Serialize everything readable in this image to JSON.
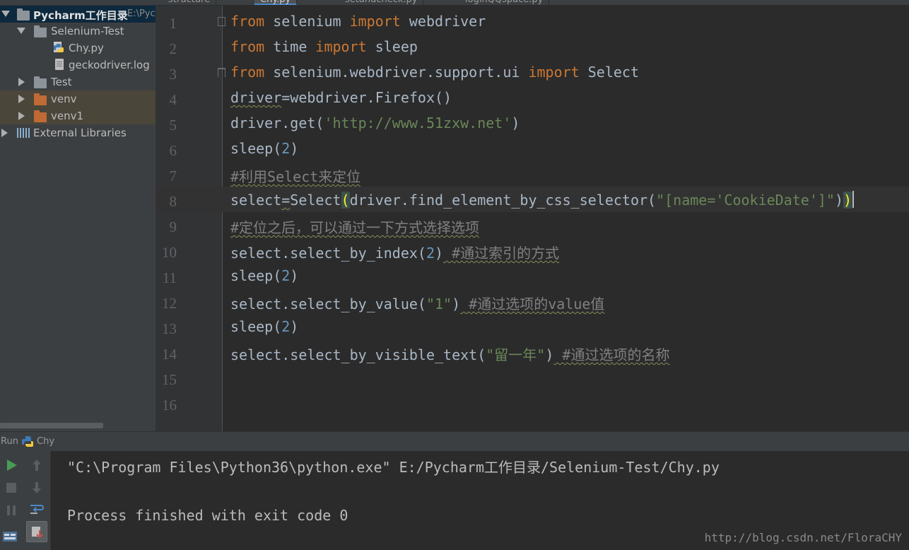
{
  "project_tree": {
    "root": {
      "label": "Pycharm工作目录",
      "path_hint": "E:\\Pyc"
    },
    "items": [
      {
        "label": "Selenium-Test"
      },
      {
        "label": "Chy.py"
      },
      {
        "label": "geckodriver.log"
      },
      {
        "label": "Test"
      },
      {
        "label": "venv"
      },
      {
        "label": "venv1"
      },
      {
        "label": "External Libraries"
      }
    ]
  },
  "editor_tabs": [
    "structure",
    "Chy.py",
    "setandcheck.py",
    "loginQQspace.py"
  ],
  "editor": {
    "line_numbers": [
      "1",
      "2",
      "3",
      "4",
      "5",
      "6",
      "7",
      "8",
      "9",
      "10",
      "11",
      "12",
      "13",
      "14",
      "15",
      "16"
    ],
    "tokens": {
      "l1": [
        "from",
        " selenium ",
        "import",
        " webdriver"
      ],
      "l2": [
        "from",
        " time ",
        "import",
        " sleep"
      ],
      "l3": [
        "from",
        " selenium.webdriver.support.ui ",
        "import",
        " Select"
      ],
      "l4": [
        "driver",
        "=webdriver.Firefox()"
      ],
      "l5": [
        "driver.get(",
        "'http://www.51zxw.net'",
        ")"
      ],
      "l6": [
        "sleep(",
        "2",
        ")"
      ],
      "l7": [
        "#利用Select来定位"
      ],
      "l8": [
        "select",
        "=",
        "Select",
        "(",
        "driver.find_element_by_css_selector(",
        "\"[name='CookieDate']\"",
        ")",
        ")"
      ],
      "l9": [
        "#定位之后，可以通过一下方式选择选项"
      ],
      "l10": [
        "select.select_by_index(",
        "2",
        ")",
        " #通过索引的方式"
      ],
      "l11": [
        "sleep(",
        "2",
        ")"
      ],
      "l12": [
        "select.select_by_value(",
        "\"1\"",
        ")",
        " #通过选项的value值"
      ],
      "l13": [
        "sleep(",
        "2",
        ")"
      ],
      "l14": [
        "select.select_by_visible_text(",
        "\"留一年\"",
        ")",
        " #通过选项的名称"
      ]
    }
  },
  "run_panel": {
    "tab_label": "Run",
    "config_name": "Chy",
    "console_lines": [
      "\"C:\\Program Files\\Python36\\python.exe\" E:/Pycharm工作目录/Selenium-Test/Chy.py",
      "",
      "Process finished with exit code 0"
    ],
    "watermark": "http://blog.csdn.net/FloraCHY"
  },
  "colors": {
    "keyword": "#cc7832",
    "string": "#6a8759",
    "number": "#6897bb",
    "comment": "#808080",
    "run_green": "#499c54"
  },
  "icons": [
    "folder-icon",
    "python-file-icon",
    "log-file-icon",
    "library-icon",
    "run-icon",
    "stop-icon",
    "pause-icon",
    "up-arrow-icon",
    "down-arrow-icon",
    "soft-wrap-icon",
    "scroll-to-end-icon",
    "layout-icon"
  ]
}
